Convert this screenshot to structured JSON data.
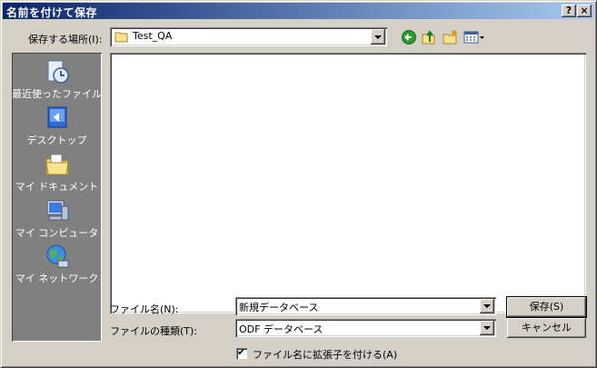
{
  "window": {
    "title": "名前を付けて保存",
    "help_button": "?",
    "close_button": "×"
  },
  "location": {
    "label": "保存する場所(I):",
    "current_folder": "Test_QA"
  },
  "toolbar": {
    "back_icon": "back-icon",
    "up_icon": "up-folder-icon",
    "new_folder_icon": "new-folder-icon",
    "views_icon": "views-menu-icon"
  },
  "places": [
    {
      "label": "最近使ったファイル",
      "icon": "recent-files-icon"
    },
    {
      "label": "デスクトップ",
      "icon": "desktop-icon"
    },
    {
      "label": "マイ ドキュメント",
      "icon": "my-documents-icon"
    },
    {
      "label": "マイ コンピュータ",
      "icon": "my-computer-icon"
    },
    {
      "label": "マイ ネットワーク",
      "icon": "my-network-icon"
    }
  ],
  "filename": {
    "label": "ファイル名(N):",
    "value": "新規データベース"
  },
  "filetype": {
    "label": "ファイルの種類(T):",
    "value": "ODF データベース"
  },
  "buttons": {
    "save": "保存(S)",
    "cancel": "キャンセル"
  },
  "extension_checkbox": {
    "label": "ファイル名に拡張子を付ける(A)",
    "checked": true,
    "mark": "✔"
  },
  "colors": {
    "title_start": "#0a246a",
    "title_end": "#a6caf0",
    "face": "#d4d0c8",
    "places_bg": "#808080"
  }
}
